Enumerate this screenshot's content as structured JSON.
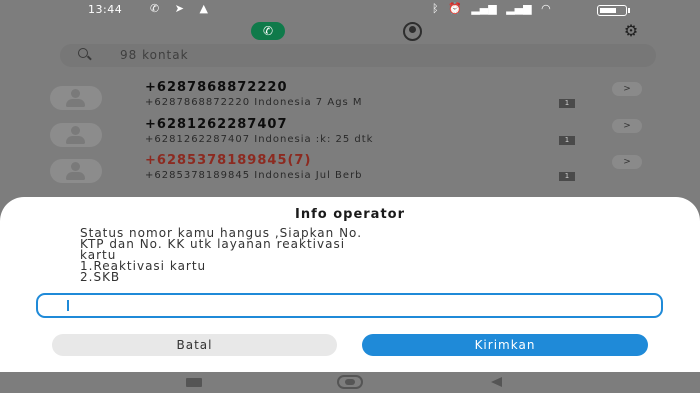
{
  "status_bar": {
    "time": "13:44",
    "left_icons": [
      "whatsapp-icon",
      "telegram-icon",
      "triangle-alert-icon"
    ],
    "right_icons": [
      "bluetooth-icon",
      "alarm-icon",
      "signal-icon",
      "signal-icon",
      "wifi-icon"
    ],
    "battery_level": 0.62
  },
  "tabs": [
    {
      "icon": "phone-icon",
      "active": true
    },
    {
      "icon": "contacts-icon",
      "active": false
    }
  ],
  "search": {
    "placeholder": "98 kontak"
  },
  "call_log": [
    {
      "number": "+6287868872220",
      "detail": "+6287868872220 Indonesia 7 Ags M",
      "sim": "1",
      "missed": false
    },
    {
      "number": "+6281262287407",
      "detail": "+6281262287407 Indonesia :k: 25 dtk",
      "sim": "1",
      "missed": false
    },
    {
      "number": "+6285378189845(7)",
      "detail": "+6285378189845 Indonesia Jul Berb",
      "sim": "1",
      "missed": true
    }
  ],
  "dialog": {
    "title": "Info operator",
    "message_lines": [
      "Status nomor kamu hangus ,Siapkan No.",
      "KTP dan No. KK utk layanan reaktivasi",
      "kartu",
      "1.Reaktivasi kartu",
      "2.SKB"
    ],
    "input_value": "",
    "cancel_label": "Batal",
    "send_label": "Kirimkan"
  },
  "colors": {
    "accent": "#1f8ad8",
    "phone_tab": "#0f7a4a",
    "missed_call": "#8c2a20",
    "dim_overlay": "#7d7d7d"
  }
}
